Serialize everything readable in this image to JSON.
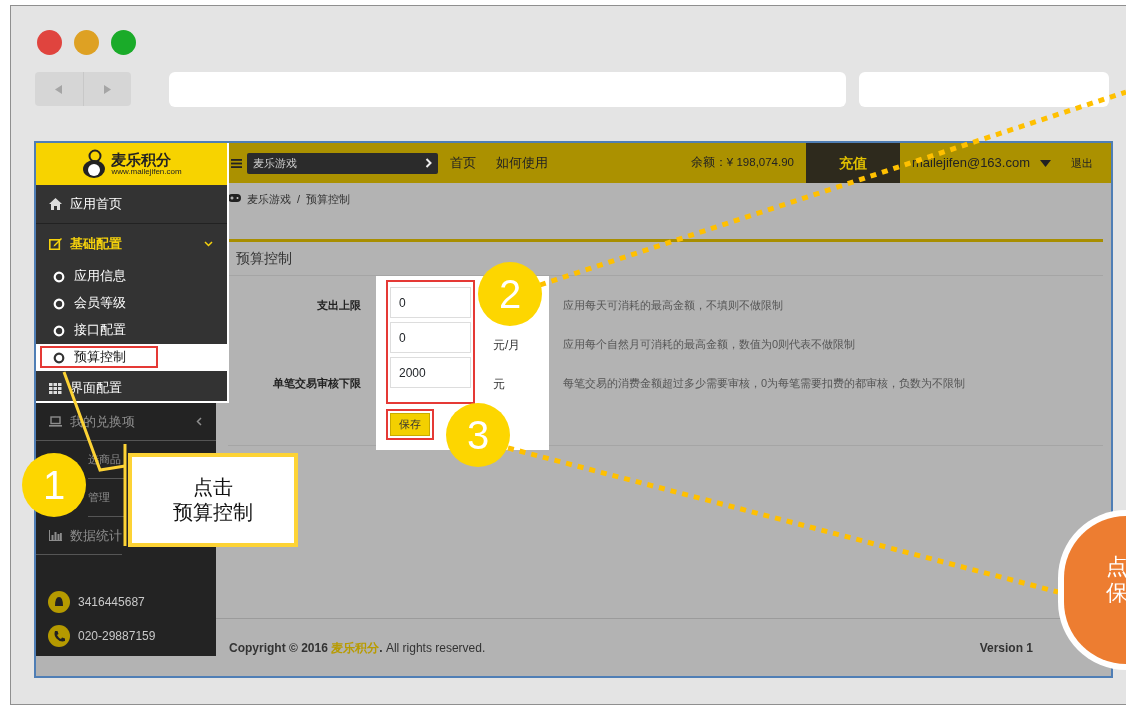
{
  "app": {
    "logo": {
      "name": "麦乐积分",
      "url": "www.mailejifen.com"
    },
    "topbar": {
      "game_select": "麦乐游戏",
      "nav": [
        {
          "label": "首页"
        },
        {
          "label": "如何使用"
        }
      ],
      "balance": "余额：¥ 198,074.90",
      "recharge": "充值",
      "account": "mailejifen@163.com",
      "logout": "退出"
    },
    "breadcrumb": {
      "separator": "/",
      "items": [
        {
          "label": "麦乐游戏"
        },
        {
          "label": "预算控制"
        }
      ]
    },
    "sidebar": {
      "items": [
        {
          "kind": "link",
          "label": "应用首页",
          "spotlit": true
        },
        {
          "kind": "group",
          "label": "基础配置",
          "spotlit": true,
          "expanded": true,
          "children": [
            {
              "label": "应用信息",
              "selected": false,
              "marked": false
            },
            {
              "label": "会员等级",
              "selected": false,
              "marked": false
            },
            {
              "label": "接口配置",
              "selected": false,
              "marked": false
            },
            {
              "label": "预算控制",
              "selected": true,
              "marked": true
            }
          ]
        },
        {
          "kind": "link",
          "label": "界面配置",
          "spotlit": true
        },
        {
          "kind": "group",
          "label": "我的兑换项",
          "spotlit": false,
          "expanded": false
        },
        {
          "kind": "link",
          "label": "选商品",
          "spotlit": false
        },
        {
          "kind": "link",
          "label": "管理",
          "spotlit": false
        },
        {
          "kind": "link",
          "label": "数据统计",
          "spotlit": false
        }
      ],
      "contacts": [
        {
          "kind": "qq",
          "value": "3416445687"
        },
        {
          "kind": "phone",
          "value": "020-29887159"
        }
      ]
    },
    "panel": {
      "title": "预算控制",
      "fields_marked": true,
      "rows": [
        {
          "label": "支出上限",
          "value": "0",
          "hint": "应用每天可消耗的最高金额，不填则不做限制"
        },
        {
          "value": "0",
          "unit": "元/月",
          "hint": "应用每个自然月可消耗的最高金额，数值为0则代表不做限制"
        },
        {
          "label": "单笔交易审核下限",
          "value": "2000",
          "unit": "元",
          "hint": "每笔交易的消费金额超过多少需要审核，0为每笔需要扣费的都审核，负数为不限制"
        }
      ],
      "save": {
        "label": "保存",
        "marked": true
      }
    },
    "footer": {
      "before": "Copyright © 2016 ",
      "brand": "麦乐积分",
      "after": ". All rights reserved.",
      "version": "Version 1"
    }
  },
  "annotations": {
    "steps": [
      {
        "number": "1"
      },
      {
        "number": "2"
      },
      {
        "number": "3"
      }
    ],
    "callout": [
      "点击",
      "预算控制"
    ],
    "bubble": [
      "点",
      "保"
    ]
  }
}
